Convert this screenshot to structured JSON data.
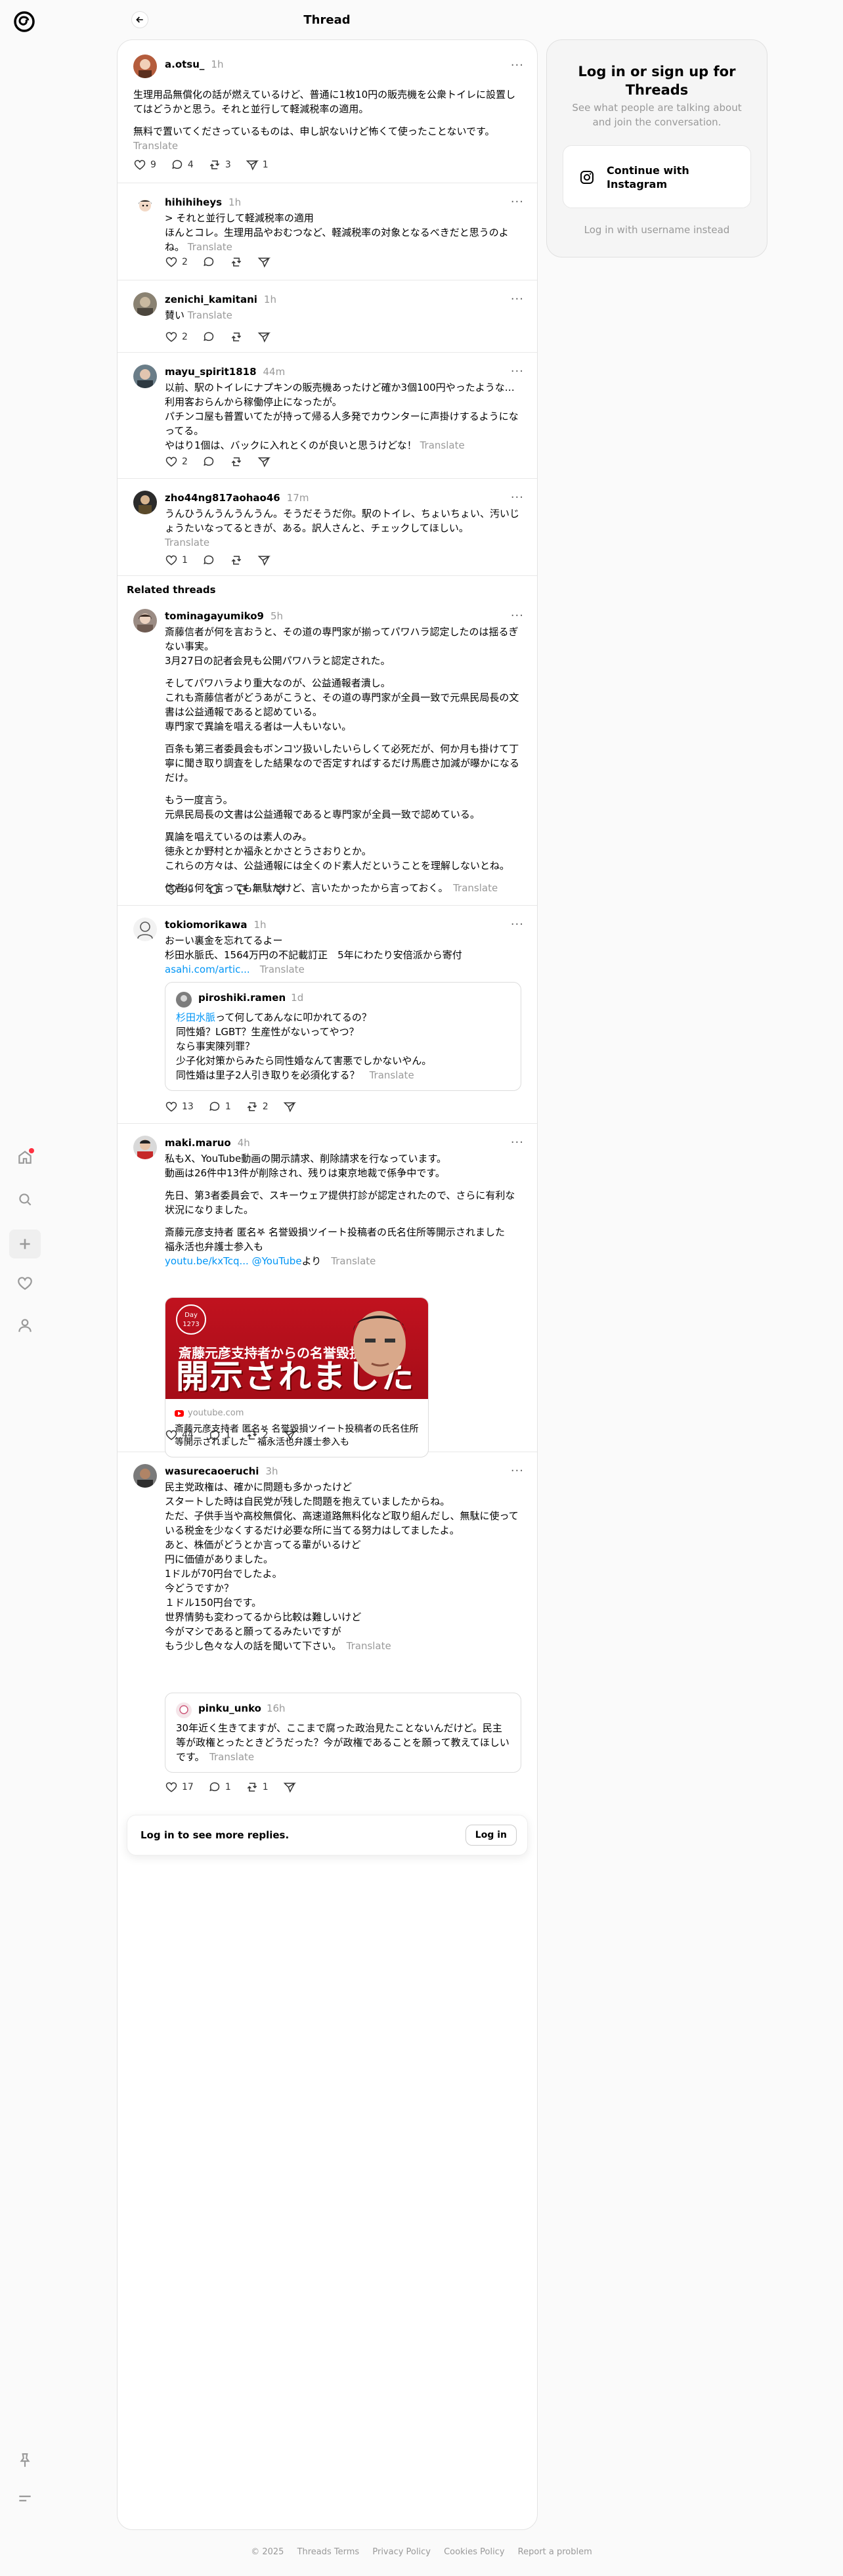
{
  "header": {
    "title": "Thread"
  },
  "main_post": {
    "username": "a.otsu_",
    "time": "1h",
    "paragraphs": [
      "生理用品無償化の話が燃えているけど、普通に1枚10円の販売機を公衆トイレに設置してはどうかと思う。それと並行して軽減税率の適用。",
      "無料で置いてくださっているものは、申し訳ないけど怖くて使ったことないです。"
    ],
    "translate": "Translate",
    "likes": "9",
    "replies": "4",
    "reposts": "3",
    "shares": "1"
  },
  "replies": [
    {
      "username": "hihihiheys",
      "time": "1h",
      "lines": [
        "> それと並行して軽減税率の適用",
        "ほんとコレ。生理用品やおむつなど、軽減税率の対象となるべきだと思うのよね。"
      ],
      "translate": "Translate",
      "likes": "2"
    },
    {
      "username": "zenichi_kamitani",
      "time": "1h",
      "lines": [
        "賛い"
      ],
      "translate": "Translate",
      "likes": "2"
    },
    {
      "username": "mayu_spirit1818",
      "time": "44m",
      "lines": [
        "以前、駅のトイレにナプキンの販売機あったけど確か3個100円やったような…",
        "利用客おらんから稼働停止になったが。",
        "パチンコ屋も普置いてたが持って帰る人多発でカウンターに声掛けするようになってる。",
        "やはり1個は、バックに入れとくのが良いと思うけどな！"
      ],
      "translate": "Translate",
      "likes": "2"
    },
    {
      "username": "zho44ng817aohao46",
      "time": "17m",
      "lines": [
        "うんひうんうんうんうん。そうだそうだ你。駅のトイレ、ちょいちょい、汚いじょうたいなってるときが、ある。訳人さんと、チェックしてほしい。"
      ],
      "translate": "Translate",
      "likes": "1"
    }
  ],
  "related_label": "Related threads",
  "related": [
    {
      "username": "tominagayumiko9",
      "time": "5h",
      "paragraphs": [
        [
          "斎藤信者が何を言おうと、その道の専門家が揃ってパワハラ認定したのは揺るぎない事実。",
          "3月27日の記者会見も公開パワハラと認定された。"
        ],
        [
          "そしてパワハラより重大なのが、公益通報者潰し。",
          "これも斎藤信者がどうあがこうと、その道の専門家が全員一致で元県民局長の文書は公益通報であると認めている。",
          "専門家で異論を唱える者は一人もいない。"
        ],
        [
          "百条も第三者委員会もボンコツ扱いしたいらしくて必死だが、何か月も掛けて丁寧に聞き取り調査をした結果なので否定すればするだけ馬鹿さ加減が曝かになるだけ。"
        ],
        [
          "もう一度言う。",
          "元県民局長の文書は公益通報であると専門家が全員一致で認めている。"
        ],
        [
          "異論を唱えているのは素人のみ。",
          "徳永とか野村とか福永とかさとうさおりとか。",
          "これらの方々は、公益通報には全くのド素人だということを理解しないとね。"
        ],
        [
          "信者に何を言っても無駄だけど、言いたかったから言っておく。"
        ]
      ],
      "translate": "Translate",
      "likes": "99",
      "reposts": "4"
    },
    {
      "username": "tokiomorikawa",
      "time": "1h",
      "lines": [
        "おーい裏金を忘れてるよー",
        "杉田水脈氏、1564万円の不記載訂正　5年にわたり安倍派から寄付"
      ],
      "link": "asahi.com/artic...",
      "translate": "Translate",
      "quote": {
        "username": "piroshiki.ramen",
        "time": "1d",
        "mention": "杉田水脈",
        "lines": [
          "って何してあんなに叩かれてるの？",
          "同性婚？LGBT？生産性がないってやつ？",
          "なら事実陳列罪？",
          "少子化対策からみたら同性婚なんて害悪でしかないやん。",
          "同性婚は里子2人引き取りを必須化する？"
        ],
        "translate": "Translate"
      },
      "likes": "13",
      "replies": "1",
      "reposts": "2"
    },
    {
      "username": "maki.maruo",
      "time": "4h",
      "paragraphs": [
        [
          "私もX、YouTube動画の開示請求、削除請求を行なっています。",
          "動画は26件中13件が削除され、残りは東京地裁で係争中です。"
        ],
        [
          "先日、第3者委員会で、スキーウェア提供打診が認定されたので、さらに有利な状況になりました。"
        ],
        [
          "斎藤元彦支持者 匿名𖤐 名誉毀損ツイート投稿者の氏名住所等開示されました　福永活也弁護士参入も"
        ]
      ],
      "link1": "youtu.be/kxTcq...",
      "link2": "@YouTube",
      "link_suffix": "より",
      "translate": "Translate",
      "card": {
        "badge_line1": "Day",
        "badge_line2": "1273",
        "caption": "斎藤元彦支持者からの名誉毀損",
        "headline": "開示されました",
        "domain": "youtube.com",
        "title": "斎藤元彦支持者 匿名𖤐 名誉毀損ツイート投稿者の氏名住所等開示されました　福永活也弁護士参入も"
      },
      "likes": "44",
      "replies": "1",
      "reposts": "2"
    },
    {
      "username": "wasurecaoeruchi",
      "time": "3h",
      "lines": [
        "民主党政権は、確かに問題も多かったけど",
        "スタートした時は自民党が残した問題を抱えていましたからね。",
        "ただ、子供手当や高校無償化、高速道路無料化など取り組んだし、無駄に使っている税金を少なくするだけ必要な所に当てる努力はしてましたよ。",
        "あと、株価がどうとか言ってる輩がいるけど",
        "円に価値がありました。",
        "1ドルが70円台でしたよ。",
        "今どうですか？",
        "１ドル150円台です。",
        "世界情勢も変わってるから比較は難しいけど",
        "今がマシであると願ってるみたいですが",
        "もう少し色々な人の話を聞いて下さい。"
      ],
      "translate": "Translate",
      "quote": {
        "username": "pinku_unko",
        "time": "16h",
        "lines": [
          "30年近く生きてますが、ここまで腐った政治見たことないんだけど。民主等が政権とったときどうだった？今が政権であることを願って教えてほしいです。"
        ],
        "translate": "Translate"
      },
      "likes": "17",
      "replies": "1",
      "reposts": "1"
    }
  ],
  "login_bar": {
    "text": "Log in to see more replies.",
    "button": "Log in"
  },
  "sidebar_card": {
    "heading": "Log in or sign up for Threads",
    "subtext": "See what people are talking about and join the conversation.",
    "button": "Continue with Instagram",
    "alt": "Log in with username instead"
  },
  "footer": {
    "copyright": "© 2025",
    "links": [
      "Threads Terms",
      "Privacy Policy",
      "Cookies Policy",
      "Report a problem"
    ]
  },
  "icons": [
    "threads-logo-icon",
    "home-icon",
    "search-icon",
    "plus-icon",
    "heart-icon",
    "profile-icon",
    "pin-icon",
    "menu-icon",
    "back-arrow-icon",
    "like-icon",
    "reply-icon",
    "repost-icon",
    "share-icon",
    "more-icon",
    "instagram-icon"
  ],
  "colors": {
    "link": "#0095f6",
    "notification": "#ff3040",
    "card_red": "#c1121f"
  }
}
